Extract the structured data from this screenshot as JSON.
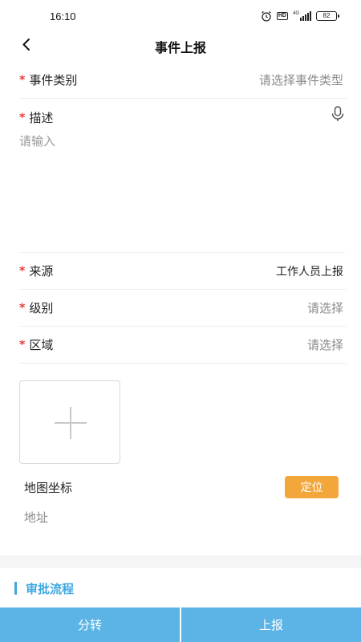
{
  "status_bar": {
    "time": "16:10",
    "icons": [
      "alarm-icon",
      "hd-icon",
      "signal-4g-icon"
    ],
    "signal_label": "4G",
    "hd_label": "HD",
    "battery_level": "82"
  },
  "nav": {
    "title": "事件上报",
    "back_icon": "chevron-left-icon"
  },
  "form": {
    "required_mark": "*",
    "event_type": {
      "label": "事件类别",
      "placeholder": "请选择事件类型"
    },
    "description": {
      "label": "描述",
      "placeholder": "请输入",
      "mic_icon": "microphone-icon"
    },
    "source": {
      "label": "来源",
      "value": "工作人员上报"
    },
    "level": {
      "label": "级别",
      "placeholder": "请选择"
    },
    "region": {
      "label": "区域",
      "placeholder": "请选择"
    }
  },
  "upload": {
    "icon": "plus-icon"
  },
  "map": {
    "label": "地图坐标",
    "locate_button": "定位",
    "address_placeholder": "地址"
  },
  "approval": {
    "title": "审批流程"
  },
  "actions": {
    "transfer_button": "分转",
    "report_button": "上报"
  },
  "colors": {
    "accent_blue": "#5bb3e6",
    "title_blue": "#3fa7e0",
    "locate_orange": "#f3a63a",
    "required_red": "#e03a3a"
  }
}
